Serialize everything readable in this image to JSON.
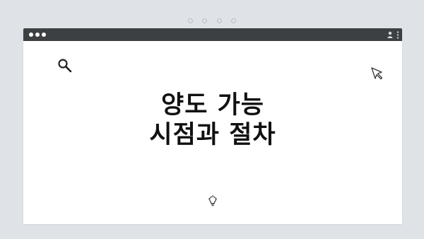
{
  "pager": {
    "dots": 4
  },
  "window": {
    "titlebar_color": "#3d4043",
    "background": "#ffffff",
    "icons": [
      "user-icon",
      "kebab-menu-icon"
    ]
  },
  "content": {
    "headline_line1": "양도 가능",
    "headline_line2": "시점과 절차",
    "icons": [
      "search-icon",
      "cursor-icon",
      "lightbulb-icon"
    ]
  },
  "colors": {
    "page_background": "#dfe3e7",
    "text": "#111111"
  }
}
